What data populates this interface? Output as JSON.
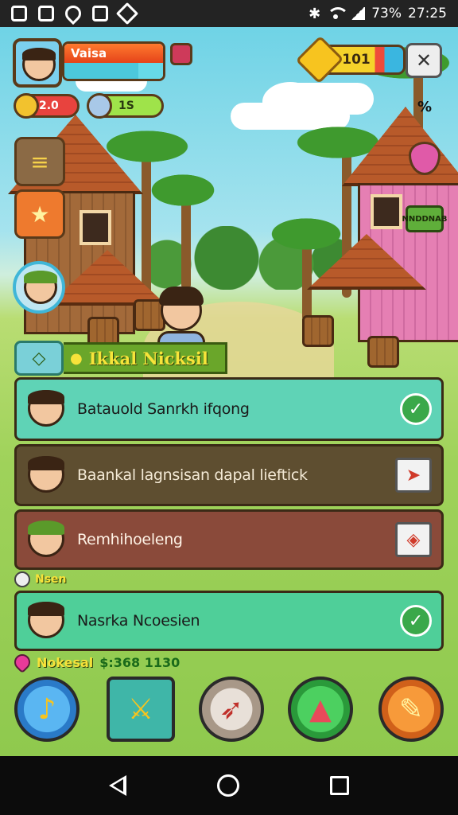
{
  "status_bar": {
    "battery": "73%",
    "time": "27:25"
  },
  "hud": {
    "player_name": "Vaisa",
    "stat_red": "2.0",
    "stat_green": "1S",
    "coins": "101",
    "bonus_label": "%",
    "house_sign": "NNDDNAB"
  },
  "quest_panel": {
    "title": "Ikkal Nicksil",
    "quests": [
      {
        "text": "Batauold Sanrkh ifqong",
        "action": "check"
      },
      {
        "text": "Baankal lagnsisan dapal lieftick",
        "action": "ticket"
      },
      {
        "text": "Remhihoeleng",
        "action": "card"
      },
      {
        "text": "Nasrka Ncoesien",
        "action": "check"
      }
    ],
    "section_label": "Nsen",
    "footer_left": "Nokesal",
    "footer_right": "$:368 1130"
  },
  "icons": {
    "status": [
      "photo-icon",
      "calendar-icon",
      "shield-icon",
      "square-icon",
      "dropbox-icon"
    ],
    "actions": [
      "horn-button",
      "swords-button",
      "compass-button",
      "rocket-button",
      "quill-button"
    ]
  },
  "colors": {
    "quest_row_1": "#5fd3b6",
    "quest_row_2": "#5e4e30",
    "quest_row_3": "#8a4a3a",
    "quest_row_4": "#4fcf99",
    "title_text": "#f7e43a"
  }
}
